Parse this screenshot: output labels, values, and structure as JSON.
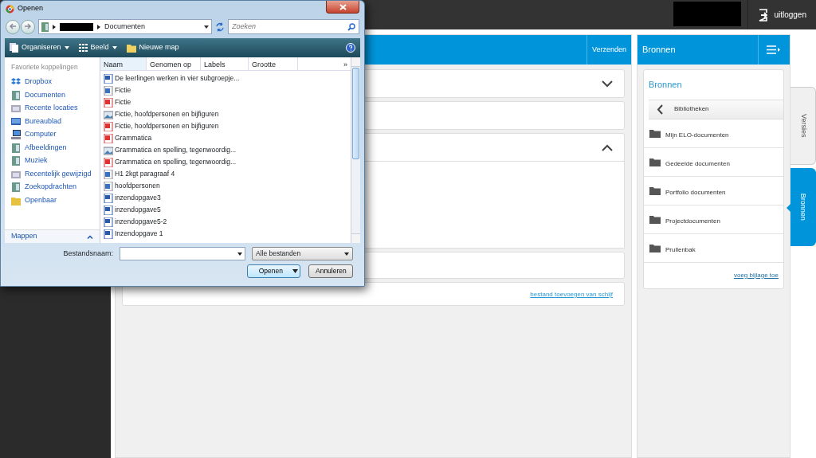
{
  "top_bar": {
    "logout": "uitloggen"
  },
  "main_panel": {
    "send_button": "Verzenden",
    "link": "bestand toevoegen van schijf",
    "sections": [
      {
        "kind": "collapsible",
        "expanded": false
      },
      {
        "kind": "plain"
      },
      {
        "kind": "collapsible",
        "expanded": true
      }
    ]
  },
  "right_panel": {
    "title": "Bronnen",
    "card_title": "Bronnen",
    "back_label": "Bibliotheken",
    "folders": [
      "Mijn ELO-documenten",
      "Gedeelde documenten",
      "Portfolio documenten",
      "Projectdocumenten",
      "Prullenbak"
    ],
    "link": "voeg bijlage toe"
  },
  "side_tabs": [
    {
      "label": "Versies",
      "selected": false
    },
    {
      "label": "Bronnen",
      "selected": true
    }
  ],
  "dialog": {
    "title": "Openen",
    "path": [
      "Documenten"
    ],
    "search": {
      "placeholder": "Zoeken"
    },
    "toolbar": [
      {
        "label": "Organiseren",
        "kind": "menu"
      },
      {
        "label": "Beeld",
        "kind": "view"
      },
      {
        "label": "Nieuwe map",
        "kind": "folder"
      }
    ],
    "favorites_header": "Favoriete koppelingen",
    "favorites": [
      {
        "label": "Dropbox",
        "kind": "dropbox"
      },
      {
        "label": "Documenten",
        "kind": "docs"
      },
      {
        "label": "Recente locaties",
        "kind": "recent"
      },
      {
        "label": "Bureaublad",
        "kind": "desktop"
      },
      {
        "label": "Computer",
        "kind": "computer"
      },
      {
        "label": "Afbeeldingen",
        "kind": "docs"
      },
      {
        "label": "Muziek",
        "kind": "docs"
      },
      {
        "label": "Recentelijk gewijzigd",
        "kind": "recent"
      },
      {
        "label": "Zoekopdrachten",
        "kind": "docs"
      },
      {
        "label": "Openbaar",
        "kind": "public"
      }
    ],
    "folders_label": "Mappen",
    "columns": [
      "Naam",
      "Genomen op",
      "Labels",
      "Grootte"
    ],
    "more_columns": "»",
    "files": [
      {
        "name": "De leerlingen werken in vier subgroepje...",
        "kind": "doc"
      },
      {
        "name": "Fictie",
        "kind": "pub"
      },
      {
        "name": "Fictie",
        "kind": "pdf"
      },
      {
        "name": "Fictie, hoofdpersonen en bijfiguren",
        "kind": "img"
      },
      {
        "name": "Fictie, hoofdpersonen en bijfiguren",
        "kind": "pdf"
      },
      {
        "name": "Grammatica",
        "kind": "pdf"
      },
      {
        "name": "Grammatica en spelling, tegenwoordig...",
        "kind": "img"
      },
      {
        "name": "Grammatica en spelling, tegenwoordig...",
        "kind": "pdf"
      },
      {
        "name": "H1 2kgt paragraaf 4",
        "kind": "pub"
      },
      {
        "name": "hoofdpersonen",
        "kind": "pub"
      },
      {
        "name": "inzendopgave3",
        "kind": "doc"
      },
      {
        "name": "inzendopgave5",
        "kind": "doc"
      },
      {
        "name": "inzendopgave5-2",
        "kind": "doc"
      },
      {
        "name": "Inzendopgave 1",
        "kind": "doc"
      }
    ],
    "filename_label": "Bestandsnaam:",
    "filter": "Alle bestanden",
    "open_button": "Openen",
    "cancel_button": "Annuleren"
  }
}
